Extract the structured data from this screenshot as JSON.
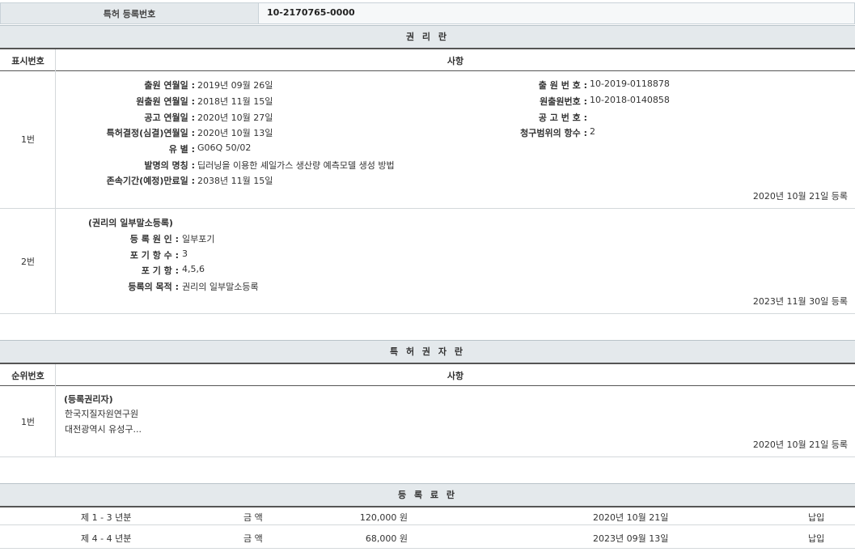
{
  "header": {
    "label": "특허 등록번호",
    "value": "10-2170765-0000"
  },
  "rights": {
    "title": "권 리 란",
    "col_num": "표시번호",
    "col_item": "사항",
    "entry1": {
      "num": "1번",
      "left": [
        {
          "label": "출원 연월일 :",
          "value": "2019년 09월 26일"
        },
        {
          "label": "원출원 연월일 :",
          "value": "2018년 11월 15일"
        },
        {
          "label": "공고 연월일 :",
          "value": "2020년 10월 27일"
        },
        {
          "label": "특허결정(심결)연월일 :",
          "value": "2020년 10월 13일"
        },
        {
          "label": "유 별 :",
          "value": "G06Q 50/02"
        },
        {
          "label": "발명의 명칭 :",
          "value": "딥러닝을 이용한 셰일가스 생산량 예측모델 생성 방법"
        },
        {
          "label": "존속기간(예정)만료일 :",
          "value": "2038년 11월 15일"
        }
      ],
      "right": [
        {
          "label": "출 원 번 호 :",
          "value": "10-2019-0118878"
        },
        {
          "label": "원출원번호 :",
          "value": "10-2018-0140858"
        },
        {
          "label": "공 고 번 호 :",
          "value": ""
        },
        {
          "label": "청구범위의 항수 :",
          "value": "2"
        }
      ],
      "date": "2020년 10월 21일 등록"
    },
    "entry2": {
      "num": "2번",
      "heading": "(권리의 일부말소등록)",
      "rows": [
        {
          "label": "등 록 원 인 :",
          "value": "일부포기"
        },
        {
          "label": "포 기 항 수 :",
          "value": "3"
        },
        {
          "label": "포 기 항 :",
          "value": "4,5,6"
        },
        {
          "label": "등록의 목적 :",
          "value": "권리의 일부말소등록"
        }
      ],
      "date": "2023년 11월 30일 등록"
    }
  },
  "holders": {
    "title": "특 허 권 자 란",
    "col_num": "순위번호",
    "col_item": "사항",
    "entry1": {
      "num": "1번",
      "heading": "(등록권리자)",
      "name": "한국지질자원연구원",
      "address": "대전광역시 유성구...",
      "date": "2020년 10월 21일 등록"
    }
  },
  "fees": {
    "title": "등 록 료 란",
    "rows": [
      {
        "period": "제 1 - 3 년분",
        "label": "금 액",
        "amount": "120,000 원",
        "date": "2020년 10월 21일",
        "status": "납입"
      },
      {
        "period": "제 4 - 4 년분",
        "label": "금 액",
        "amount": "68,000 원",
        "date": "2023년 09월 13일",
        "status": "납입"
      }
    ]
  }
}
